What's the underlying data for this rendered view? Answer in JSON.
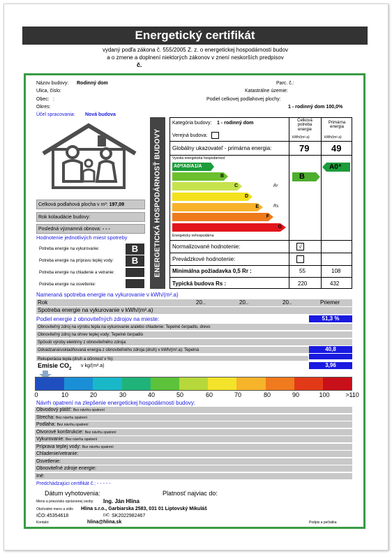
{
  "title": "Energetický certifikát",
  "subtitle_1": "vydaný podľa zákona č. 555/2005 Z. z. o energetickej hospodárnosti budov",
  "subtitle_2": "a o zmene a doplnení niektorých zákonov v znení neskorších predpisov",
  "subtitle_3": "č.",
  "building": {
    "name_label": "Názov budovy:",
    "name": "Rodinný dom",
    "street_label": "Ulica, číslo:",
    "town_label": "Obec:",
    "town": ":",
    "district_label": "Okres:",
    "parcel_label": "Parc. č.:",
    "cadastre_label": "Katastrálne územie:",
    "floor_share_label": "Podiel celkovej podlahovej plochy:",
    "floor_share": "1 - rodinný dom 100,0%",
    "purpose_label": "Účel spracovania:",
    "purpose": "Nová budova"
  },
  "left_panel": {
    "floor_area_label": "Celková podlahová plocha v m²:",
    "floor_area": "197,09",
    "approval_year_label": "Rok kolaudácie budovy:",
    "last_renovation_label": "Posledná významná obnova:",
    "last_renovation": "- - -",
    "consumption_heading": "Hodnotenie jednotlivých miest spotreby",
    "items": [
      {
        "label": "Potreba energie na vykurovanie:",
        "grade": "B"
      },
      {
        "label": "Potreba energie na prípravu teplej vody:",
        "grade": "B"
      },
      {
        "label": "Potreba energie na chladenie a vetranie:",
        "grade": ""
      },
      {
        "label": "Potreba energie na osvetlenie:",
        "grade": ""
      }
    ]
  },
  "vertical_label": "ENERGETICKÁ HOSPODÁRNOSŤ BUDOVY",
  "center": {
    "category_label": "Kategória budovy:",
    "category": "1 - rodinný dom",
    "public_label": "Verejná budova:",
    "global_label": "Globálny ukazovateľ - primárna energia:",
    "col_delivered_1": "Celková potreba energie",
    "col_primary_1": "Primárna energia",
    "col_unit": "kWh/(m².a)",
    "global_delivered": "79",
    "global_primary": "49",
    "high_label": "Vysoká energetická hospodárnosť",
    "low_label": "Energeticky nehospodárna",
    "scale_labels": [
      "A0*/A0/A1/A",
      "B",
      "C",
      "D",
      "E",
      "F",
      "G"
    ],
    "rr": "Rr",
    "rs": "Rs",
    "delivered_class": "B",
    "primary_class": "A0⁺",
    "normalized_label": "Normalizované hodnotenie:",
    "normalized_mark": "√",
    "operational_label": "Prevádzkové hodnotenie:",
    "min_req_label": "Minimálna požiadavka 0,5 Rr :",
    "min_req_delivered": "55",
    "min_req_primary": "108",
    "typical_label": "Typická budova Rs :",
    "typical_delivered": "220",
    "typical_primary": "432"
  },
  "measured": {
    "heading": "Nameraná spotreba energie na vykurovanie v kWh/(m².a)",
    "year_label": "Rok",
    "years": [
      "20..",
      "20..",
      "20.."
    ],
    "avg_label": "Priemer",
    "heating_label": "Spotreba energie na vykurovanie v kWh/(m².a)"
  },
  "renewable": {
    "heading": "Podiel energie z obnoviteľných zdrojov na mieste:",
    "value": "51,3 %",
    "rows": [
      "Obnoviteľný zdroj na výrobu tepla na vykurovanie a/alebo chladenie: Tepelné čerpadlo, drevo",
      "Obnoviteľný zdroj na ohrev teplej vody: Tepelné čerpadlo",
      "Spôsob výroby elektriny z obnoviteľného zdroja:",
      "Odvádzaná/uskladňovaná energia z obnoviteľného zdroja (druh) v kWh/(m².a): Tepelná",
      "Rekuperácia tepla (druh a účinnosť v %):"
    ],
    "stored_value": "40,8"
  },
  "co2": {
    "label": "Emisie CO",
    "label_sub": "2",
    "unit": "v kg/(m².a)",
    "value": "3,96"
  },
  "scale_ticks": [
    "0",
    "10",
    "20",
    "30",
    "40",
    "50",
    "60",
    "70",
    "80",
    "90",
    "100",
    ">110"
  ],
  "measures": {
    "heading": "Návrh opatrení na zlepšenie energetickej hospodárnosti budovy:",
    "rows": [
      {
        "label": "Obvodový plášť:",
        "value": "Bez návrhu opatrení"
      },
      {
        "label": "Strecha:",
        "value": "Bez návrhu opatrení"
      },
      {
        "label": "Podlaha:",
        "value": "Bez návrhu opatrení"
      },
      {
        "label": "Otvorové konštrukcie:",
        "value": "Bez návrhu opatrení"
      },
      {
        "label": "Vykurovanie:",
        "value": "Bez návrhu opatrení"
      },
      {
        "label": "Príprava teplej vody:",
        "value": "Bez návrhu opatrení"
      },
      {
        "label": "Chladenie/vetranie:",
        "value": ""
      },
      {
        "label": "Osvetlenie:",
        "value": ""
      },
      {
        "label": "Obnoviteľné zdroje energie:",
        "value": ""
      },
      {
        "label": "Iné:",
        "value": ""
      }
    ]
  },
  "previous_label": "Predchádzajúci certifikát č.: - - - - -",
  "footer": {
    "issue_date_label": "Dátum vyhotovenia:",
    "valid_label": "Platnosť najviac do:",
    "person_label": "Meno a priezvisko oprávnenej osoby:",
    "person": "Ing. Ján Hlina",
    "company_label": "Obchodné meno a sídlo",
    "company": "Hlina s.r.o., Garbiarska 2583, 031 01 Liptovský Mikuláš",
    "ico_label": "IČO:",
    "ico": "45354618",
    "dic_label": "DIČ:",
    "dic": "SK2022982467",
    "contact_label": "Kontakt:",
    "contact": "hlina@hlina.sk",
    "signature_label": "Podpis a pečiatka"
  }
}
